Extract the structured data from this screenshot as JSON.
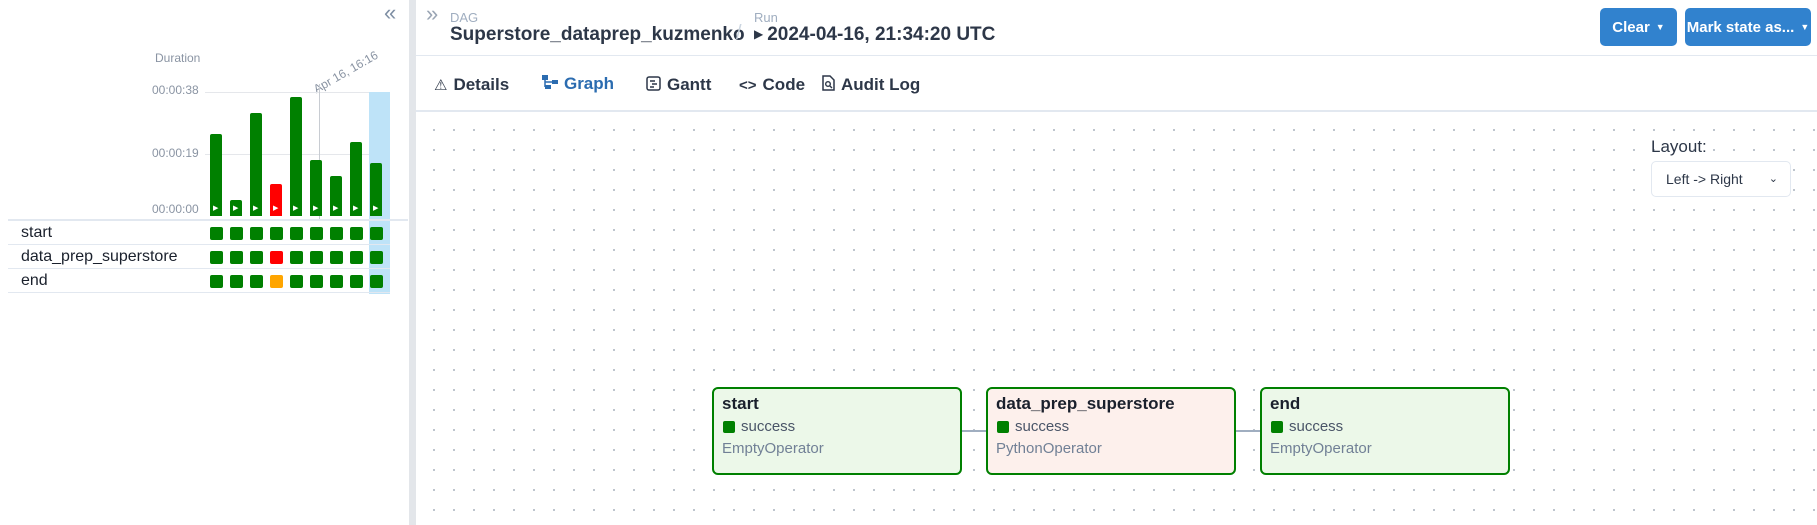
{
  "grid": {
    "duration_label": "Duration",
    "date_label": "Apr 16, 16:16",
    "ticks": [
      "00:00:38",
      "00:00:19",
      "00:00:00"
    ],
    "runs": [
      {
        "state": "success",
        "duration_s": 31
      },
      {
        "state": "success",
        "duration_s": 6
      },
      {
        "state": "success",
        "duration_s": 39
      },
      {
        "state": "failed",
        "duration_s": 12
      },
      {
        "state": "success",
        "duration_s": 45
      },
      {
        "state": "success",
        "duration_s": 21
      },
      {
        "state": "success",
        "duration_s": 15
      },
      {
        "state": "success",
        "duration_s": 28
      },
      {
        "state": "success",
        "duration_s": 20
      }
    ],
    "tasks": [
      {
        "name": "start",
        "states": [
          "success",
          "success",
          "success",
          "success",
          "success",
          "success",
          "success",
          "success",
          "success"
        ]
      },
      {
        "name": "data_prep_superstore",
        "states": [
          "success",
          "success",
          "success",
          "failed",
          "success",
          "success",
          "success",
          "success",
          "success"
        ]
      },
      {
        "name": "end",
        "states": [
          "success",
          "success",
          "success",
          "upstream_failed",
          "success",
          "success",
          "success",
          "success",
          "success"
        ]
      }
    ],
    "colors": {
      "success": "#008000",
      "failed": "#ff0000",
      "upstream_failed": "#ffa500"
    }
  },
  "header": {
    "dag_label": "DAG",
    "dag_id": "Superstore_dataprep_kuzmenko",
    "separator": "/",
    "run_label": "Run",
    "run_value": "2024-04-16, 21:34:20 UTC",
    "clear_button": "Clear",
    "mark_state_button": "Mark state as..."
  },
  "tabs": [
    {
      "label": "Details",
      "icon": "warning-icon",
      "active": false
    },
    {
      "label": "Graph",
      "icon": "graph-icon",
      "active": true
    },
    {
      "label": "Gantt",
      "icon": "gantt-icon",
      "active": false
    },
    {
      "label": "Code",
      "icon": "code-icon",
      "active": false
    },
    {
      "label": "Audit Log",
      "icon": "audit-log-icon",
      "active": false
    }
  ],
  "graph": {
    "layout_label": "Layout:",
    "layout_value": "Left -> Right",
    "nodes": [
      {
        "name": "start",
        "state": "success",
        "operator": "EmptyOperator",
        "bg": "#ecf8e9"
      },
      {
        "name": "data_prep_superstore",
        "state": "success",
        "operator": "PythonOperator",
        "bg": "#fdf0ec"
      },
      {
        "name": "end",
        "state": "success",
        "operator": "EmptyOperator",
        "bg": "#ecf8e9"
      }
    ]
  },
  "accent_color": "#3182ce"
}
